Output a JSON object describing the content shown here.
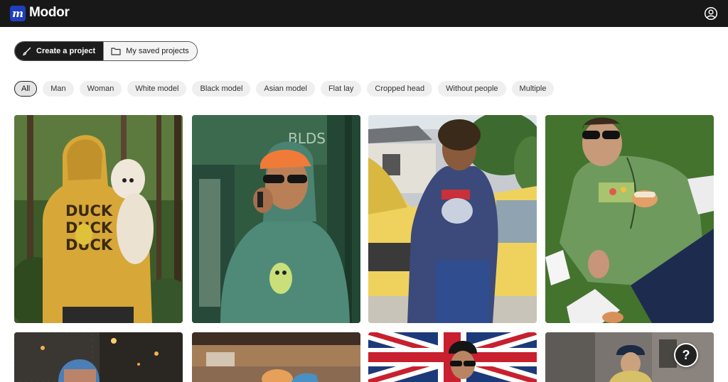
{
  "app": {
    "logo_letter": "m",
    "name": "Modor",
    "brand_color": "#1f3fbf"
  },
  "header": {
    "account_icon": "account-circle-icon"
  },
  "segmented": {
    "create_label": "Create a project",
    "create_icon": "brush-icon",
    "saved_label": "My saved projects",
    "saved_icon": "folder-icon"
  },
  "filters": [
    {
      "label": "All",
      "active": true
    },
    {
      "label": "Man"
    },
    {
      "label": "Woman"
    },
    {
      "label": "White model"
    },
    {
      "label": "Black model"
    },
    {
      "label": "Asian model"
    },
    {
      "label": "Flat lay"
    },
    {
      "label": "Cropped head"
    },
    {
      "label": "Without people"
    },
    {
      "label": "Multiple"
    }
  ],
  "mockups": [
    {
      "name": "mockup-yellow-hoodie-dog",
      "hoodie_print": [
        "DUCK",
        "DUCK",
        "DUCK"
      ]
    },
    {
      "name": "mockup-teal-hoodie-phone",
      "sign_text": "BLDS"
    },
    {
      "name": "mockup-navy-hoodie-car"
    },
    {
      "name": "mockup-green-hoodie-picnic"
    },
    {
      "name": "mockup-cap-night-street"
    },
    {
      "name": "mockup-train-station"
    },
    {
      "name": "mockup-union-flag"
    },
    {
      "name": "mockup-stone-building"
    }
  ],
  "help": {
    "label": "?"
  }
}
